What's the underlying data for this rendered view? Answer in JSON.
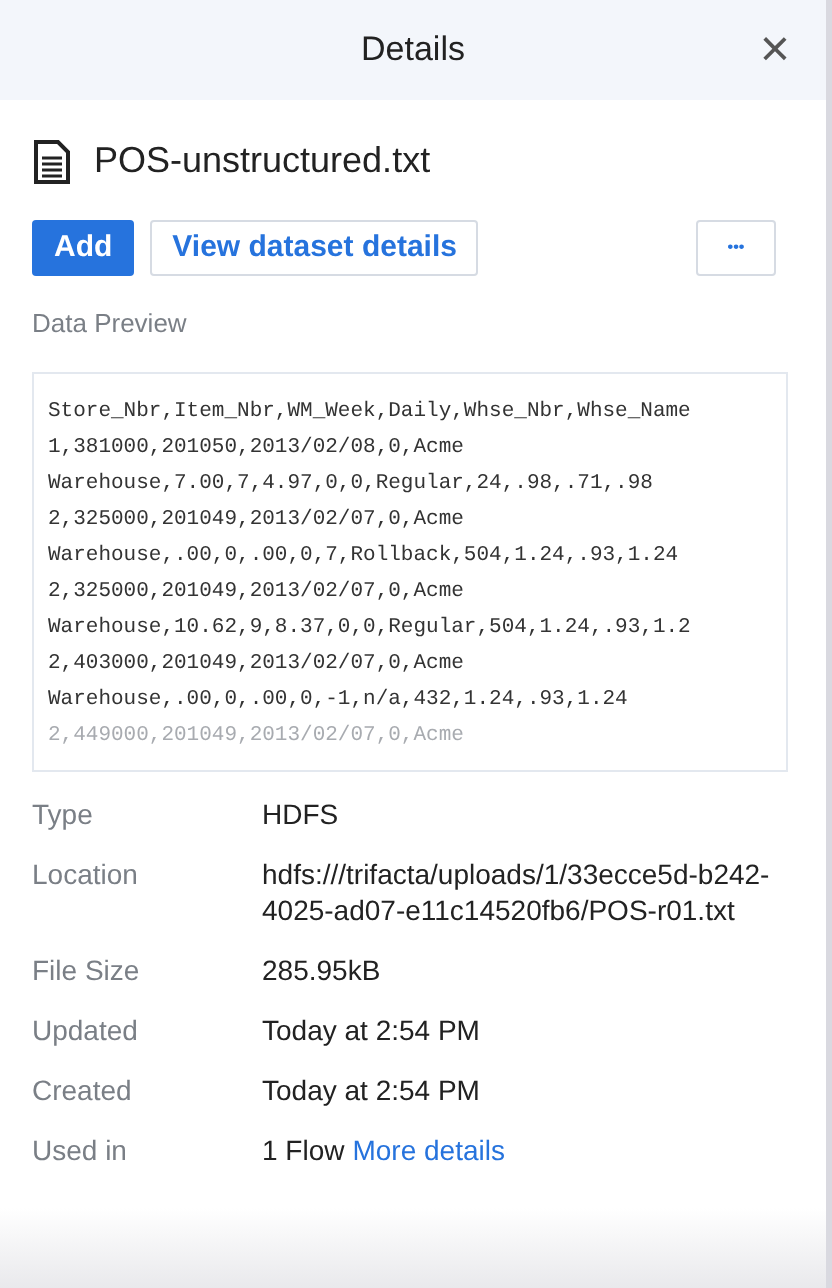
{
  "header": {
    "title": "Details",
    "close": "×"
  },
  "file": {
    "name": "POS-unstructured.txt"
  },
  "actions": {
    "primary": "Add",
    "secondary": "View dataset details",
    "more": "•••"
  },
  "preview": {
    "label": "Data Preview",
    "lines": [
      {
        "text": "Store_Nbr,Item_Nbr,WM_Week,Daily,Whse_Nbr,Whse_Name",
        "faded": false
      },
      {
        "text": "1,381000,201050,2013/02/08,0,Acme",
        "faded": false
      },
      {
        "text": "Warehouse,7.00,7,4.97,0,0,Regular,24,.98,.71,.98",
        "faded": false
      },
      {
        "text": "2,325000,201049,2013/02/07,0,Acme",
        "faded": false
      },
      {
        "text": "Warehouse,.00,0,.00,0,7,Rollback,504,1.24,.93,1.24",
        "faded": false
      },
      {
        "text": "2,325000,201049,2013/02/07,0,Acme",
        "faded": false
      },
      {
        "text": "Warehouse,10.62,9,8.37,0,0,Regular,504,1.24,.93,1.2",
        "faded": false
      },
      {
        "text": "2,403000,201049,2013/02/07,0,Acme",
        "faded": false
      },
      {
        "text": "Warehouse,.00,0,.00,0,-1,n/a,432,1.24,.93,1.24",
        "faded": false
      },
      {
        "text": "2,449000,201049,2013/02/07,0,Acme",
        "faded": true
      }
    ]
  },
  "properties": [
    {
      "label": "Type",
      "value": "HDFS"
    },
    {
      "label": "Location",
      "value": "hdfs:///trifacta/uploads/1/33ecce5d-b242-4025-ad07-e11c14520fb6/POS-r01.txt"
    },
    {
      "label": "File Size",
      "value": "285.95kB"
    },
    {
      "label": "Updated",
      "value": "Today at 2:54 PM"
    },
    {
      "label": "Created",
      "value": "Today at 2:54 PM"
    },
    {
      "label": "Used in",
      "value": "1 Flow",
      "link": "More details"
    }
  ]
}
